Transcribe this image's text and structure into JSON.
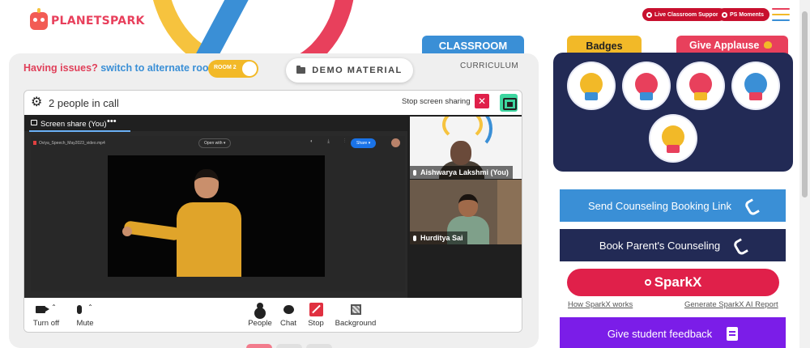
{
  "header": {
    "logo_text": "PLANETSPARK",
    "support_label": "Live Classroom Support",
    "moments_label": "PS Moments",
    "colors": {
      "brand_red": "#c8102e",
      "menu_lines": [
        "#e8405c",
        "#f2b928",
        "#3a8fd6"
      ]
    }
  },
  "tabs": {
    "classroom": "CLASSROOM",
    "curriculum": "CURRICULUM"
  },
  "issues": {
    "question": "Having issues?",
    "suggestion": "switch to alternate room",
    "room_toggle": "ROOM 2"
  },
  "demo_button": "DEMO MATERIAL",
  "call": {
    "people_count": "2 people in call",
    "stop_share": "Stop screen sharing",
    "close_glyph": "✕",
    "share_label": "Screen share (You)",
    "share_menu": "•••",
    "file_name": "Oviya_Speech_May2023_video.mp4",
    "open_with": "Open with ▾",
    "share_mini": "Share ▾",
    "participants": [
      {
        "name": "Aishwarya Lakshmi (You)"
      },
      {
        "name": "Hurditya Sai"
      }
    ],
    "controls": [
      {
        "label": "Turn off",
        "icon": "camera-icon"
      },
      {
        "label": "Mute",
        "icon": "microphone-icon"
      },
      {
        "label": "People",
        "icon": "people-icon"
      },
      {
        "label": "Chat",
        "icon": "chat-icon"
      },
      {
        "label": "Stop",
        "icon": "stop-share-icon"
      },
      {
        "label": "Background",
        "icon": "background-icon"
      }
    ]
  },
  "right": {
    "badges_tab": "Badges",
    "applause_tab": "Give Applause",
    "badge_count": 5,
    "buttons": {
      "counseling_link": "Send Counseling Booking Link",
      "parent_counseling": "Book Parent's Counseling",
      "sparkx": "SparkX",
      "how_sparkx": "How SparkX works",
      "generate_report": "Generate SparkX AI Report",
      "feedback": "Give student feedback"
    }
  }
}
